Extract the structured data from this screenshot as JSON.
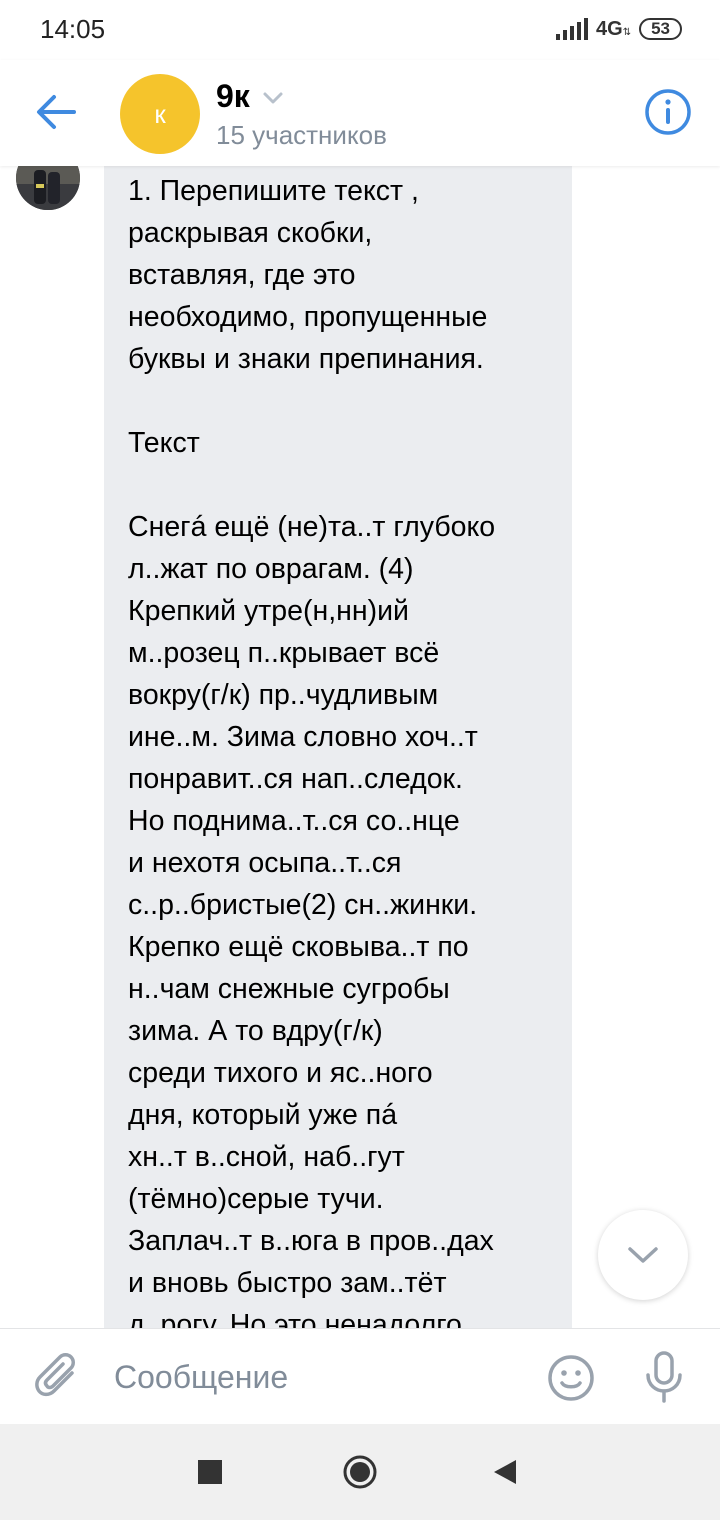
{
  "status_bar": {
    "time": "14:05",
    "network": "4G",
    "battery": "53"
  },
  "header": {
    "avatar_letter": "к",
    "title": "9к",
    "subtitle": "15 участников"
  },
  "message": {
    "text": "1. Перепишите текст ,\nраскрывая скобки,\nвставляя, где это\nнеобходимо, пропущенные\nбуквы и знаки препинания.\n\nТекст\n\nСнегá ещё (не)та..т глубоко\nл..жат по оврагам. (4)\nКрепкий утре(н,нн)ий\nм..розец п..крывает всё\nвокру(г/к) пр..чудливым\nине..м. Зима словно хоч..т\nпонравит..ся нап..следок.\nНо поднима..т..ся со..нце\nи нехотя осыпа..т..ся\nс..р..бристые(2) сн..жинки.\nКрепко ещё сковыва..т по\nн..чам снежные сугробы\nзима. А то вдру(г/к)\nсреди тихого и яс..ного\nдня, который уже пá\nхн..т в..сной, наб..гут\n(тёмно)серые тучи.\nЗаплач..т в..юга в пров..дах\nи вновь быстро зам..тёт\nд..рогу. Но это ненадолго."
  },
  "composer": {
    "placeholder": "Сообщение"
  },
  "colors": {
    "accent": "#3f8ae0",
    "avatar_bg": "#f5c42c",
    "bubble_bg": "#ebedf0",
    "secondary_text": "#818c99"
  },
  "icons": {
    "back": "arrow-left-icon",
    "dropdown": "chevron-down-icon",
    "info": "info-icon",
    "scroll": "chevron-down-icon",
    "attach": "paperclip-icon",
    "emoji": "smile-icon",
    "mic": "microphone-icon"
  }
}
